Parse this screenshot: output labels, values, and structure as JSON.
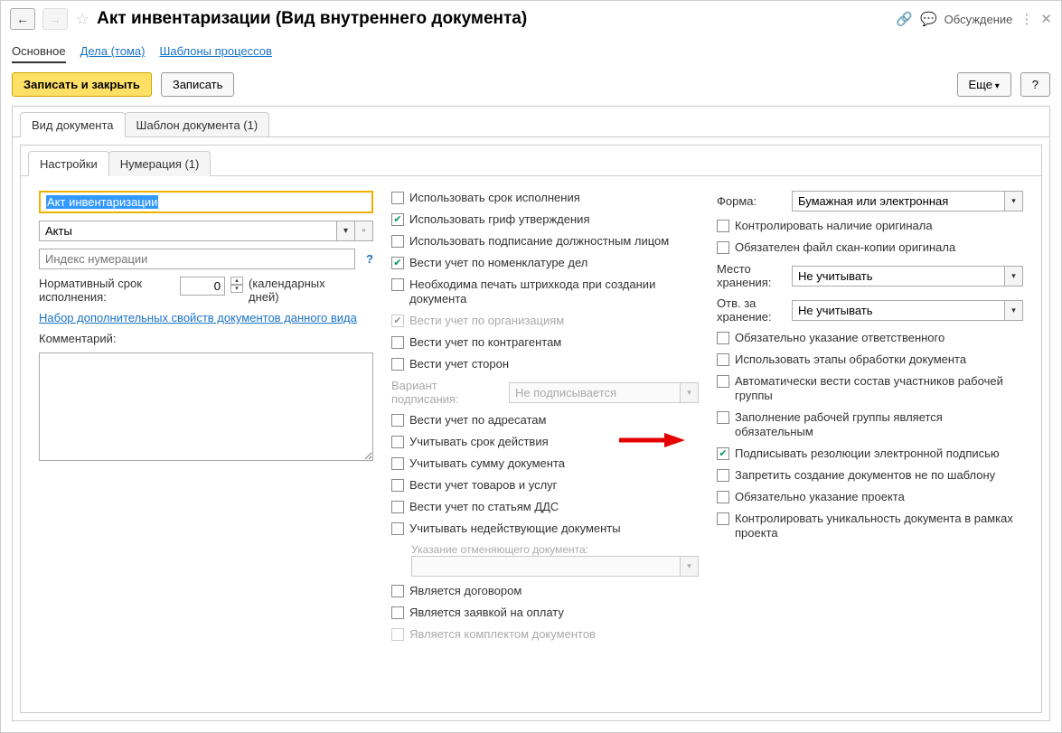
{
  "header": {
    "title": "Акт инвентаризации (Вид внутреннего документа)",
    "discuss": "Обсуждение"
  },
  "navtabs": {
    "main": "Основное",
    "cases": "Дела (тома)",
    "templates": "Шаблоны процессов"
  },
  "toolbar": {
    "save_close": "Записать и закрыть",
    "save": "Записать",
    "more": "Еще",
    "help": "?"
  },
  "tabs1": {
    "doc_kind": "Вид документа",
    "doc_tpl": "Шаблон документа (1)"
  },
  "tabs2": {
    "settings": "Настройки",
    "numbering": "Нумерация (1)"
  },
  "left": {
    "name_value": "Акт инвентаризации",
    "group_value": "Акты",
    "num_index_placeholder": "Индекс нумерации",
    "norm_label": "Нормативный срок исполнения:",
    "norm_value": "0",
    "norm_unit": "(календарных дней)",
    "addprops_link": "Набор дополнительных свойств документов данного вида",
    "comment_label": "Комментарий:"
  },
  "mid": {
    "c1": "Использовать срок исполнения",
    "c2": "Использовать гриф утверждения",
    "c3": "Использовать подписание должностным лицом",
    "c4": "Вести учет по номенклатуре дел",
    "c5": "Необходима печать штрихкода при создании документа",
    "c6": "Вести учет по организациям",
    "c7": "Вести учет по контрагентам",
    "c8": "Вести учет сторон",
    "sign_variant_lbl": "Вариант подписания:",
    "sign_variant_val": "Не подписывается",
    "c9": "Вести учет по адресатам",
    "c10": "Учитывать срок действия",
    "c11": "Учитывать сумму документа",
    "c12": "Вести учет товаров и услуг",
    "c13": "Вести учет по статьям ДДС",
    "c14": "Учитывать недействующие документы",
    "cancel_doc_lbl": "Указание отменяющего документа:",
    "c15": "Является договором",
    "c16": "Является заявкой на оплату",
    "c17": "Является комплектом документов"
  },
  "right": {
    "form_lbl": "Форма:",
    "form_val": "Бумажная или электронная",
    "r1": "Контролировать наличие оригинала",
    "r2": "Обязателен файл скан-копии оригинала",
    "store_lbl": "Место хранения:",
    "store_val": "Не учитывать",
    "resp_lbl": "Отв. за хранение:",
    "resp_val": "Не учитывать",
    "r3": "Обязательно указание ответственного",
    "r4": "Использовать этапы обработки документа",
    "r5": "Автоматически вести состав участников рабочей группы",
    "r6": "Заполнение рабочей группы является обязательным",
    "r7": "Подписывать резолюции электронной подписью",
    "r8": "Запретить создание документов не по шаблону",
    "r9": "Обязательно указание проекта",
    "r10": "Контролировать уникальность документа в рамках проекта"
  }
}
